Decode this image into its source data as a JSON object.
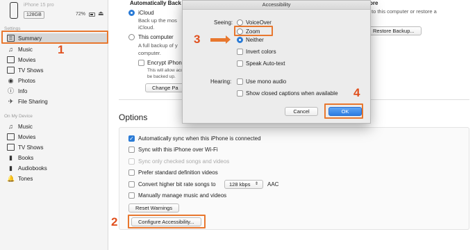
{
  "sidebar": {
    "device_name": "iPhone 15 pro",
    "capacity": "128GB",
    "battery": "72%",
    "settings_label": "Settings",
    "settings_items": [
      {
        "label": "Summary",
        "icon": "summary-icon"
      },
      {
        "label": "Music",
        "icon": "music-icon"
      },
      {
        "label": "Movies",
        "icon": "movies-icon"
      },
      {
        "label": "TV Shows",
        "icon": "tv-icon"
      },
      {
        "label": "Photos",
        "icon": "camera-icon"
      },
      {
        "label": "Info",
        "icon": "info-icon"
      },
      {
        "label": "File Sharing",
        "icon": "file-sharing-icon"
      }
    ],
    "device_label": "On My Device",
    "device_items": [
      {
        "label": "Music",
        "icon": "music-icon"
      },
      {
        "label": "Movies",
        "icon": "movies-icon"
      },
      {
        "label": "TV Shows",
        "icon": "tv-icon"
      },
      {
        "label": "Books",
        "icon": "books-icon"
      },
      {
        "label": "Audiobooks",
        "icon": "audiobooks-icon"
      },
      {
        "label": "Tones",
        "icon": "bell-icon"
      }
    ]
  },
  "backup": {
    "heading": "Automatically Back",
    "heading_right": "ore",
    "icloud_label": "iCloud",
    "icloud_desc_1": "Back up the mos",
    "icloud_desc_2": "iCloud.",
    "computer_label": "This computer",
    "computer_desc_1": "A full backup of y",
    "computer_desc_2": "computer.",
    "encrypt_label": "Encrypt iPhon",
    "encrypt_desc_1": "This will allow acc",
    "encrypt_desc_2": "be backed up.",
    "change_password": "Change Pa",
    "right_desc": "to this computer or restore a",
    "restore_button": "Restore Backup..."
  },
  "options": {
    "title": "Options",
    "items": [
      {
        "label": "Automatically sync when this iPhone is connected",
        "checked": true,
        "disabled": false
      },
      {
        "label": "Sync with this iPhone over Wi-Fi",
        "checked": false,
        "disabled": false
      },
      {
        "label": "Sync only checked songs and videos",
        "checked": false,
        "disabled": true
      },
      {
        "label": "Prefer standard definition videos",
        "checked": false,
        "disabled": false
      },
      {
        "label": "Convert higher bit rate songs to",
        "checked": false,
        "disabled": false
      },
      {
        "label": "Manually manage music and videos",
        "checked": false,
        "disabled": false
      }
    ],
    "bitrate_value": "128 kbps",
    "bitrate_format": "AAC",
    "reset_warnings": "Reset Warnings",
    "configure_accessibility": "Configure Accessibility..."
  },
  "dialog": {
    "title": "Accessibility",
    "seeing_label": "Seeing:",
    "seeing_options": [
      "VoiceOver",
      "Zoom",
      "Neither"
    ],
    "selected_option": "Neither",
    "seeing_checks": [
      "Invert colors",
      "Speak Auto-text"
    ],
    "hearing_label": "Hearing:",
    "hearing_checks": [
      "Use mono audio",
      "Show closed captions when available"
    ],
    "cancel": "Cancel",
    "ok": "OK"
  },
  "annotations": {
    "step1": "1",
    "step2": "2",
    "step3": "3",
    "step4": "4",
    "color": "#e8772e"
  }
}
